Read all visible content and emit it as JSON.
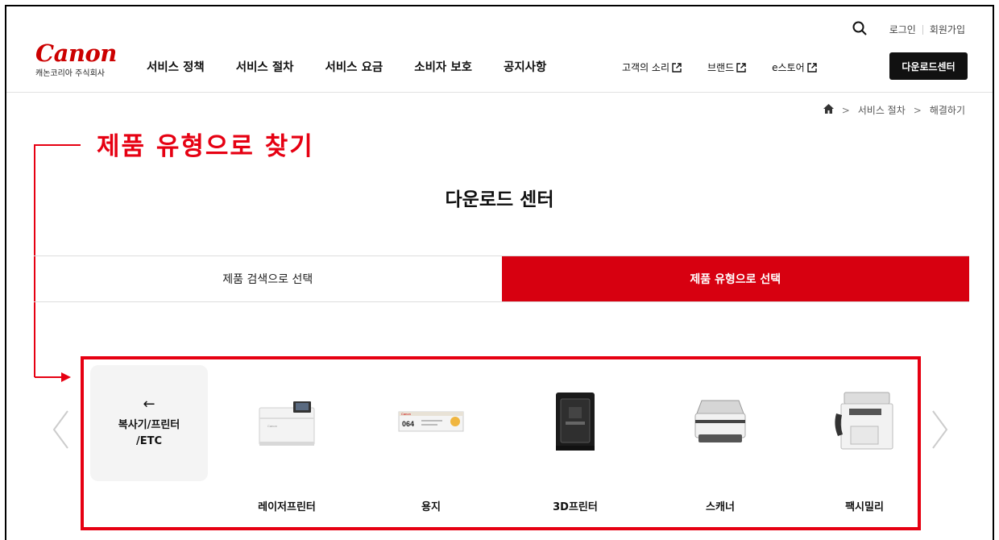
{
  "utility": {
    "login": "로그인",
    "signup": "회원가입"
  },
  "logo": {
    "brand": "Canon",
    "subtitle": "캐논코리아 주식회사"
  },
  "nav": {
    "main": [
      "서비스 정책",
      "서비스 절차",
      "서비스 요금",
      "소비자 보호",
      "공지사항"
    ],
    "external": [
      "고객의 소리",
      "브랜드",
      "e스토어"
    ],
    "download_button": "다운로드센터"
  },
  "breadcrumb": {
    "items": [
      "서비스 절차",
      "해결하기"
    ]
  },
  "annotation": "제품 유형으로 찾기",
  "page_title": "다운로드 센터",
  "tabs": [
    {
      "label": "제품 검색으로 선택",
      "active": false
    },
    {
      "label": "제품 유형으로 선택",
      "active": true
    }
  ],
  "category": {
    "back_arrow": "←",
    "back_label_line1": "복사기/프린터",
    "back_label_line2": "/ETC",
    "products": [
      {
        "label": "레이저프린터",
        "icon": "laser-printer-image"
      },
      {
        "label": "용지",
        "icon": "toner-image"
      },
      {
        "label": "3D프린터",
        "icon": "3d-printer-image"
      },
      {
        "label": "스캐너",
        "icon": "scanner-image"
      },
      {
        "label": "팩시밀리",
        "icon": "fax-image"
      }
    ]
  },
  "colors": {
    "accent": "#d70010",
    "annotation": "#e60012",
    "dark": "#111111"
  }
}
